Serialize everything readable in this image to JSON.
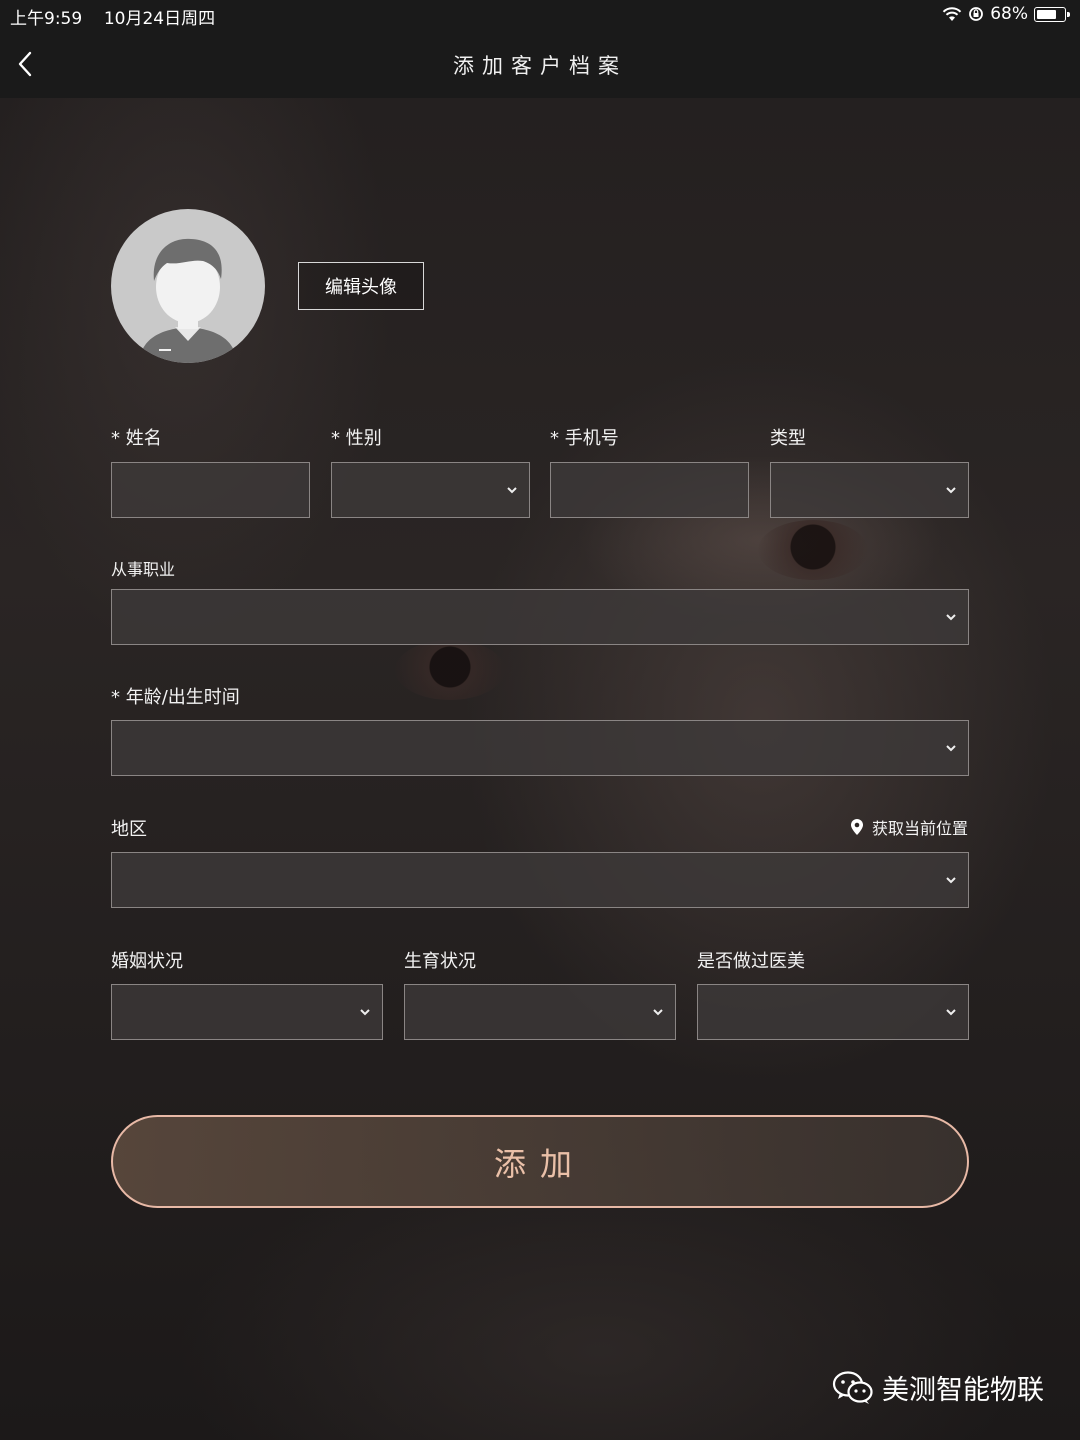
{
  "status": {
    "time": "上午9:59",
    "date": "10月24日周四",
    "battery": "68%",
    "battery_level": 0.68
  },
  "nav": {
    "title": "添加客户档案"
  },
  "avatar": {
    "edit_label": "编辑头像"
  },
  "form": {
    "name": {
      "label": "* 姓名",
      "value": ""
    },
    "gender": {
      "label": "* 性别",
      "value": ""
    },
    "phone": {
      "label": "* 手机号",
      "value": ""
    },
    "type": {
      "label": "类型",
      "value": ""
    },
    "occupation": {
      "label": "从事职业",
      "value": ""
    },
    "age": {
      "label": "* 年龄/出生时间",
      "value": ""
    },
    "region": {
      "label": "地区",
      "value": "",
      "locate_label": "获取当前位置"
    },
    "marital": {
      "label": "婚姻状况",
      "value": ""
    },
    "fertility": {
      "label": "生育状况",
      "value": ""
    },
    "aesthetic": {
      "label": "是否做过医美",
      "value": ""
    }
  },
  "submit": {
    "label": "添加"
  },
  "watermark": {
    "text": "美测智能物联"
  },
  "colors": {
    "accent": "#e8b9a6",
    "field_border": "#8a8584",
    "bar": "#1a1a1a"
  }
}
